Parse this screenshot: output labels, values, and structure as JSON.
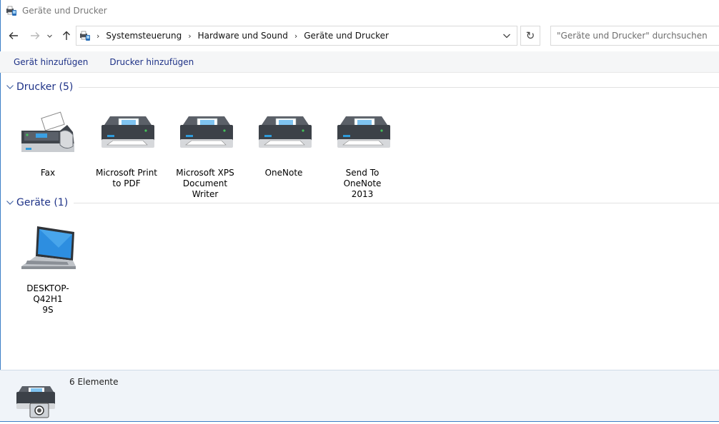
{
  "window": {
    "title": "Geräte und Drucker"
  },
  "nav": {
    "back_icon": "arrow-left-icon",
    "forward_icon": "arrow-right-icon",
    "recent_icon": "chevron-down-icon",
    "up_icon": "arrow-up-icon",
    "breadcrumbs": [
      "Systemsteuerung",
      "Hardware und Sound",
      "Geräte und Drucker"
    ],
    "refresh_glyph": "↻",
    "search_placeholder": "\"Geräte und Drucker\" durchsuchen"
  },
  "commands": {
    "add_device": "Gerät hinzufügen",
    "add_printer": "Drucker hinzufügen"
  },
  "groups": {
    "printers": {
      "title": "Drucker (5)",
      "items": [
        {
          "label_line1": "Fax",
          "label_line2": "",
          "icon": "fax-icon"
        },
        {
          "label_line1": "Microsoft Print",
          "label_line2": "to PDF",
          "icon": "printer-icon"
        },
        {
          "label_line1": "Microsoft XPS",
          "label_line2": "Document Writer",
          "icon": "printer-icon"
        },
        {
          "label_line1": "OneNote",
          "label_line2": "",
          "icon": "printer-icon"
        },
        {
          "label_line1": "Send To OneNote",
          "label_line2": "2013",
          "icon": "printer-icon"
        }
      ]
    },
    "devices": {
      "title": "Geräte (1)",
      "items": [
        {
          "label_line1": "DESKTOP-Q42H1",
          "label_line2": "9S",
          "icon": "laptop-icon"
        }
      ]
    }
  },
  "details": {
    "count": "6 Elemente",
    "icon": "devices-printers-icon"
  },
  "colors": {
    "link": "#1e3287",
    "accent": "#3d7fc7",
    "details_bg": "#f0f4f9"
  }
}
